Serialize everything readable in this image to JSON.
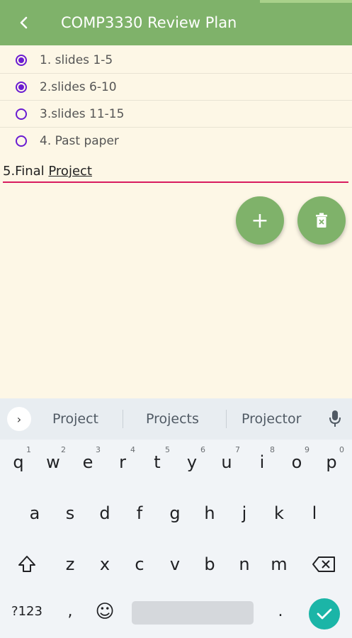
{
  "header": {
    "title": "COMP3330 Review Plan",
    "back_icon": "chevron-left-icon"
  },
  "items": [
    {
      "label": "1. slides 1-5",
      "checked": true
    },
    {
      "label": "2.slides 6-10",
      "checked": true
    },
    {
      "label": "3.slides 11-15",
      "checked": false
    },
    {
      "label": "4. Past paper",
      "checked": false
    }
  ],
  "new_item": {
    "prefix": "5.Final ",
    "composing": "Project"
  },
  "fabs": {
    "add": "+",
    "delete_icon": "delete-icon"
  },
  "keyboard": {
    "suggestions": [
      "Project",
      "Projects",
      "Projector"
    ],
    "row1": [
      "q",
      "w",
      "e",
      "r",
      "t",
      "y",
      "u",
      "i",
      "o",
      "p"
    ],
    "row1_hints": [
      "1",
      "2",
      "3",
      "4",
      "5",
      "6",
      "7",
      "8",
      "9",
      "0"
    ],
    "row2": [
      "a",
      "s",
      "d",
      "f",
      "g",
      "h",
      "j",
      "k",
      "l"
    ],
    "row3": [
      "z",
      "x",
      "c",
      "v",
      "b",
      "n",
      "m"
    ],
    "symbols_label": "?123",
    "comma": ",",
    "period": ".",
    "emoji": "☺"
  },
  "colors": {
    "primary": "#7fb26a",
    "radio": "#6a1bd1",
    "underline": "#d81b60",
    "enter": "#1bb5a7",
    "background": "#fdf7e6"
  }
}
